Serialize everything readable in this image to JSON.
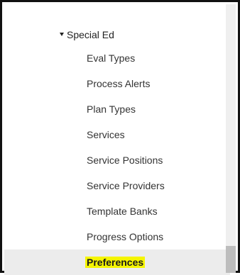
{
  "section": {
    "label": "Special Ed",
    "expanded": true
  },
  "items": [
    {
      "label": "Eval Types"
    },
    {
      "label": "Process Alerts"
    },
    {
      "label": "Plan Types"
    },
    {
      "label": "Services"
    },
    {
      "label": "Service Positions"
    },
    {
      "label": "Service Providers"
    },
    {
      "label": "Template Banks"
    },
    {
      "label": "Progress Options"
    },
    {
      "label": "Preferences",
      "active": true,
      "highlighted": true
    }
  ],
  "colors": {
    "highlight": "#f5f500",
    "active_row": "#ececec",
    "border": "#111111"
  }
}
